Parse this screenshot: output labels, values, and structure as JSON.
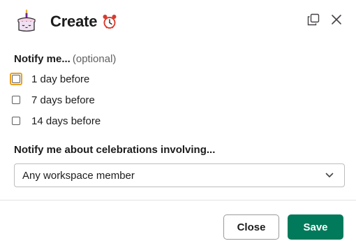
{
  "header": {
    "title": "Create",
    "title_emoji": "alarm-clock-icon",
    "app_icon": "birthday-cake-icon",
    "copy_icon": "copy-icon",
    "close_icon": "close-icon"
  },
  "notify": {
    "label": "Notify me...",
    "optional": "(optional)",
    "options": [
      {
        "label": "1 day before",
        "checked": false,
        "focused": true
      },
      {
        "label": "7 days before",
        "checked": false,
        "focused": false
      },
      {
        "label": "14 days before",
        "checked": false,
        "focused": false
      }
    ]
  },
  "celebrations": {
    "label": "Notify me about celebrations involving...",
    "selected": "Any workspace member"
  },
  "footer": {
    "close_label": "Close",
    "save_label": "Save"
  },
  "colors": {
    "primary": "#007a5a",
    "focus": "#e8a01d"
  }
}
